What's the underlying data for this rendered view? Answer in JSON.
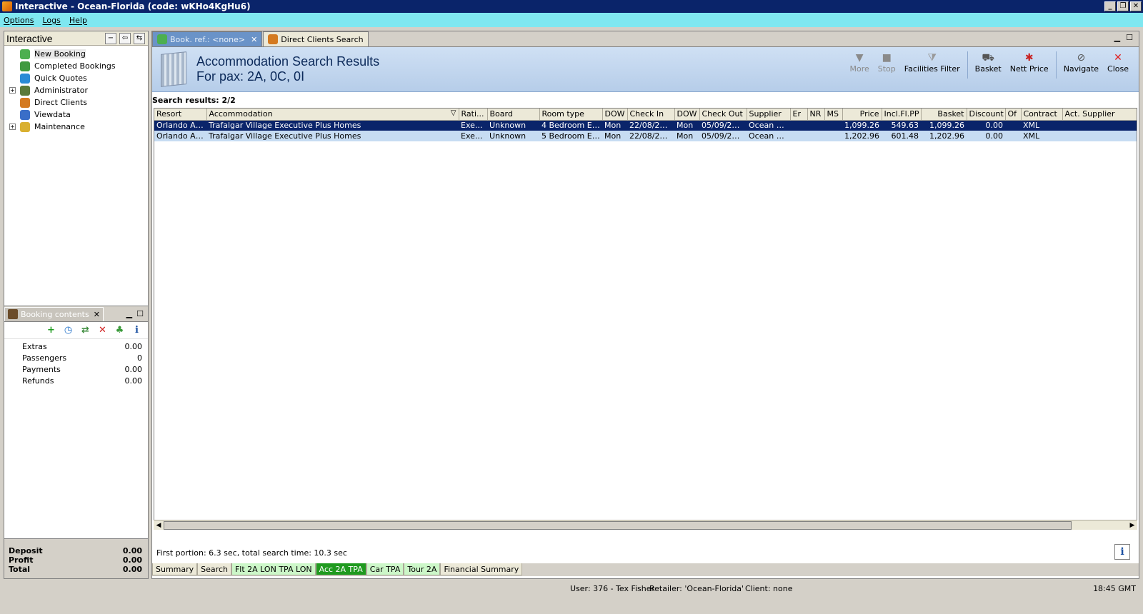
{
  "window": {
    "title": "Interactive - Ocean-Florida (code: wKHo4KgHu6)",
    "minimize": "_",
    "restore": "❐",
    "close": "✕"
  },
  "menu": {
    "items": [
      "Options",
      "Logs",
      "Help"
    ]
  },
  "navigator": {
    "title": "Interactive",
    "items": [
      {
        "label": "New Booking",
        "icon": "palm-tree-icon",
        "expandable": false,
        "color": "#4caf50"
      },
      {
        "label": "Completed Bookings",
        "icon": "palm-tree-icon",
        "expandable": false,
        "color": "#3f9a3f"
      },
      {
        "label": "Quick Quotes",
        "icon": "clock-icon",
        "expandable": false,
        "color": "#2a8bd6"
      },
      {
        "label": "Administrator",
        "icon": "person-icon",
        "expandable": true,
        "color": "#5a7a3a"
      },
      {
        "label": "Direct Clients",
        "icon": "clients-icon",
        "expandable": false,
        "color": "#d47a20"
      },
      {
        "label": "Viewdata",
        "icon": "globe-icon",
        "expandable": false,
        "color": "#3a6ec8"
      },
      {
        "label": "Maintenance",
        "icon": "toolbox-icon",
        "expandable": true,
        "color": "#d9b030"
      }
    ]
  },
  "booking_contents": {
    "tab_label": "Booking contents",
    "rows": [
      {
        "label": "Extras",
        "value": "0.00"
      },
      {
        "label": "Passengers",
        "value": "0"
      },
      {
        "label": "Payments",
        "value": "0.00"
      },
      {
        "label": "Refunds",
        "value": "0.00"
      }
    ],
    "summary": [
      {
        "label": "Deposit",
        "value": "0.00"
      },
      {
        "label": "Profit",
        "value": "0.00"
      },
      {
        "label": "Total",
        "value": "0.00"
      }
    ]
  },
  "tabs": [
    {
      "label": "Book. ref.: <none>",
      "active": true
    },
    {
      "label": "Direct Clients Search",
      "active": false
    }
  ],
  "results_header": {
    "title": "Accommodation Search Results",
    "subtitle": "For pax: 2A, 0C, 0I",
    "tools": [
      {
        "label": "More",
        "disabled": true
      },
      {
        "label": "Stop",
        "disabled": true
      },
      {
        "label": "Facilities Filter",
        "disabled": false
      },
      {
        "label": "Basket",
        "disabled": false
      },
      {
        "label": "Nett Price",
        "disabled": false
      },
      {
        "label": "Navigate",
        "disabled": false
      },
      {
        "label": "Close",
        "disabled": false
      }
    ]
  },
  "search_results_label": "Search results: 2/2",
  "grid": {
    "columns": [
      "Resort",
      "Accommodation",
      "Rati...",
      "Board",
      "Room type",
      "DOW",
      "Check In",
      "DOW",
      "Check Out",
      "Supplier",
      "Er",
      "NR",
      "MS",
      "Price",
      "Incl.Fl.PP",
      "Basket",
      "Discount",
      "Of",
      "Contract",
      "Act. Supplier"
    ],
    "rows": [
      [
        "Orlando Ar...",
        "Trafalgar Village Executive Plus Homes",
        "Exe...",
        "Unknown",
        "4 Bedroom Exe...",
        "Mon",
        "22/08/2016",
        "Mon",
        "05/09/2016",
        "Ocean B...",
        "",
        "",
        "",
        "1,099.26",
        "549.63",
        "1,099.26",
        "0.00",
        "",
        "XML",
        ""
      ],
      [
        "Orlando Ar...",
        "Trafalgar Village Executive Plus Homes",
        "Exe...",
        "Unknown",
        "5 Bedroom Exe...",
        "Mon",
        "22/08/2016",
        "Mon",
        "05/09/2016",
        "Ocean B...",
        "",
        "",
        "",
        "1,202.96",
        "601.48",
        "1,202.96",
        "0.00",
        "",
        "XML",
        ""
      ]
    ]
  },
  "timing": "First portion: 6.3 sec, total search time: 10.3 sec",
  "bottom_tabs": [
    {
      "label": "Summary",
      "style": "plain"
    },
    {
      "label": "Search",
      "style": "plain"
    },
    {
      "label": "Flt 2A LON TPA LON",
      "style": "green"
    },
    {
      "label": "Acc 2A TPA",
      "style": "green-active"
    },
    {
      "label": "Car TPA",
      "style": "green"
    },
    {
      "label": "Tour 2A",
      "style": "green"
    },
    {
      "label": "Financial Summary",
      "style": "plain"
    }
  ],
  "status": {
    "user": "User: 376 - Tex Fisher",
    "retailer": "Retailer: 'Ocean-Florida'",
    "client": "Client: none",
    "time": "18:45 GMT"
  }
}
